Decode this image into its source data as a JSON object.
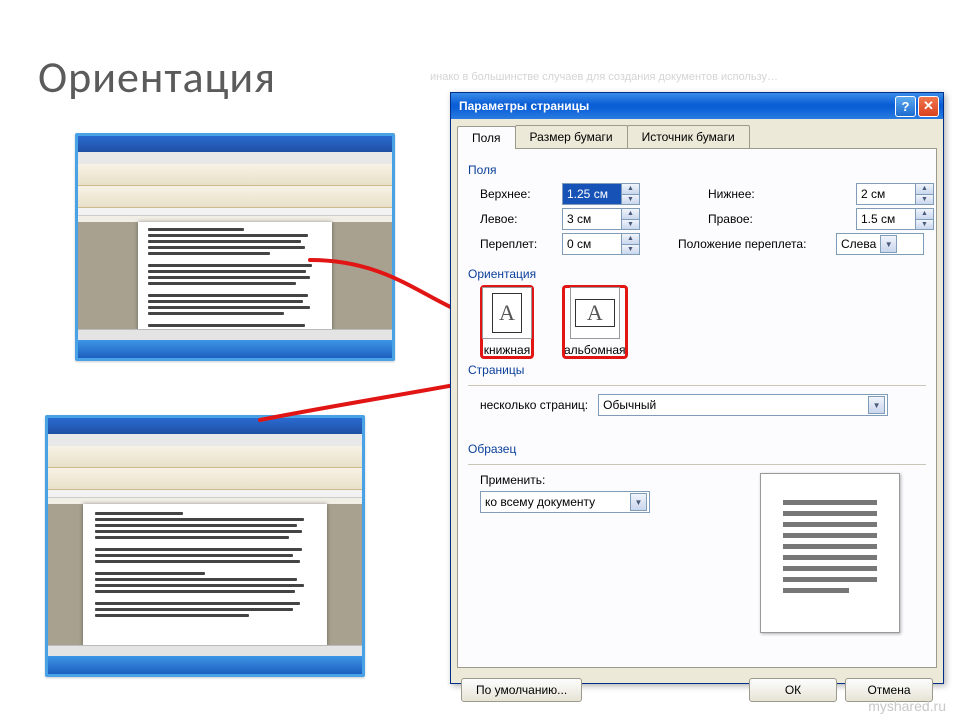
{
  "slide": {
    "title": "Ориентация"
  },
  "watermark": "myshared.ru",
  "dialog": {
    "title": "Параметры страницы",
    "tabs": [
      "Поля",
      "Размер бумаги",
      "Источник бумаги"
    ],
    "active_tab": 0,
    "section_margins": "Поля",
    "margins": {
      "top_label": "Верхнее:",
      "top_value": "1.25 см",
      "bottom_label": "Нижнее:",
      "bottom_value": "2 см",
      "left_label": "Левое:",
      "left_value": "3 см",
      "right_label": "Правое:",
      "right_value": "1.5 см",
      "gutter_label": "Переплет:",
      "gutter_value": "0 см",
      "gutter_pos_label": "Положение переплета:",
      "gutter_pos_value": "Слева"
    },
    "section_orientation": "Ориентация",
    "orientation": {
      "portrait": "книжная",
      "landscape": "альбомная"
    },
    "section_pages": "Страницы",
    "pages": {
      "multi_label": "несколько страниц:",
      "multi_value": "Обычный"
    },
    "section_preview": "Образец",
    "apply": {
      "label": "Применить:",
      "value": "ко всему документу"
    },
    "buttons": {
      "default": "По умолчанию...",
      "ok": "ОК",
      "cancel": "Отмена"
    }
  }
}
